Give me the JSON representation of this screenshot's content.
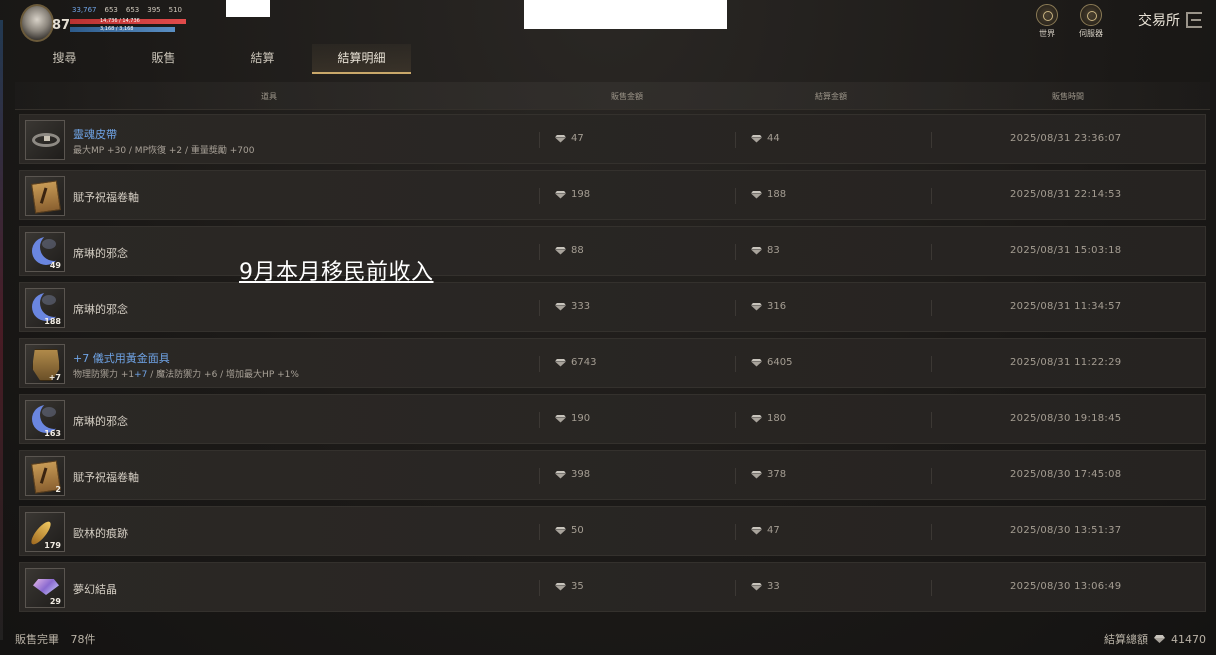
{
  "hud": {
    "level": "87",
    "stats": [
      "33,767",
      "653",
      "653",
      "395",
      "510"
    ],
    "hp_text": "14,736 / 14,736",
    "mp_text": "3,168 / 3,168"
  },
  "top_right": {
    "world_label": "世界",
    "server_label": "伺服器",
    "exchange_label": "交易所"
  },
  "tabs": [
    {
      "label": "搜尋"
    },
    {
      "label": "販售"
    },
    {
      "label": "結算"
    },
    {
      "label": "結算明細"
    }
  ],
  "active_tab": "結算明細",
  "columns": {
    "item": "道具",
    "sale_amount": "販售金額",
    "settle_amount": "結算金額",
    "sale_time": "販售時間"
  },
  "rows": [
    {
      "icon": "belt-icon",
      "count": "",
      "name": "靈魂皮帶",
      "name_blue": true,
      "desc": "最大MP +30 / MP恢復 +2 / 重量獎勵 +700",
      "sale": "47",
      "settle": "44",
      "time": "2025/08/31 23:36:07"
    },
    {
      "icon": "scroll-icon",
      "count": "",
      "name": "賦予祝福卷軸",
      "name_blue": false,
      "desc": "",
      "sale": "198",
      "settle": "188",
      "time": "2025/08/31 22:14:53"
    },
    {
      "icon": "crescent-moon-icon",
      "count": "49",
      "name": "席琳的邪念",
      "name_blue": false,
      "desc": "",
      "sale": "88",
      "settle": "83",
      "time": "2025/08/31 15:03:18"
    },
    {
      "icon": "crescent-moon-icon",
      "count": "188",
      "name": "席琳的邪念",
      "name_blue": false,
      "desc": "",
      "sale": "333",
      "settle": "316",
      "time": "2025/08/31 11:34:57"
    },
    {
      "icon": "golden-mask-icon",
      "count": "+7",
      "name": "+7 儀式用黃金面具",
      "name_blue": true,
      "desc_parts": [
        "物理防禦力 +1",
        "+7",
        " / 魔法防禦力 +6 / 增加最大HP +1%"
      ],
      "sale": "6743",
      "settle": "6405",
      "time": "2025/08/31 11:22:29"
    },
    {
      "icon": "crescent-moon-icon",
      "count": "163",
      "name": "席琳的邪念",
      "name_blue": false,
      "desc": "",
      "sale": "190",
      "settle": "180",
      "time": "2025/08/30 19:18:45"
    },
    {
      "icon": "scroll-icon",
      "count": "2",
      "name": "賦予祝福卷軸",
      "name_blue": false,
      "desc": "",
      "sale": "398",
      "settle": "378",
      "time": "2025/08/30 17:45:08"
    },
    {
      "icon": "feather-icon",
      "count": "179",
      "name": "歐林的痕跡",
      "name_blue": false,
      "desc": "",
      "sale": "50",
      "settle": "47",
      "time": "2025/08/30 13:51:37"
    },
    {
      "icon": "crystal-icon",
      "count": "29",
      "name": "夢幻結晶",
      "name_blue": false,
      "desc": "",
      "sale": "35",
      "settle": "33",
      "time": "2025/08/30 13:06:49"
    }
  ],
  "overlay_text": "9月本月移民前收入",
  "footer": {
    "sold_label": "販售完畢",
    "sold_count": "78件",
    "total_label": "結算總額",
    "total_value": "41470"
  }
}
